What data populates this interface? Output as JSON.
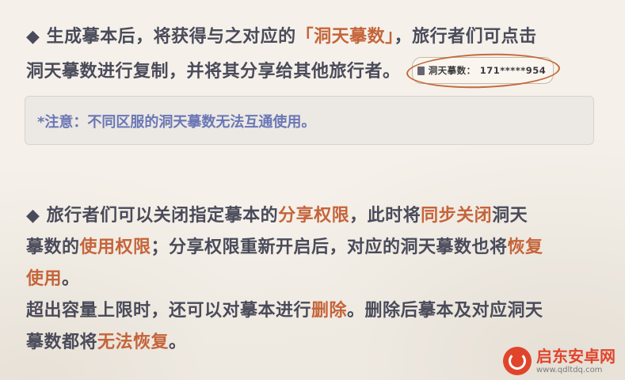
{
  "section1": {
    "bullet": "◆",
    "line1_a": "生成摹本后，将获得与之对应的",
    "line1_bracket_open": "「",
    "line1_hl": "洞天摹数",
    "line1_bracket_close": "」",
    "line1_b": "，旅行者们可点击",
    "line2": "洞天摹数进行复制，并将其分享给其他旅行者。",
    "chip_label": "洞天摹数：",
    "chip_value": "171*****954"
  },
  "note": {
    "text": "*注意：不同区服的洞天摹数无法互通使用。"
  },
  "section2": {
    "bullet": "◆",
    "l1_a": "旅行者们可以关闭指定摹本的",
    "l1_hl1": "分享权限",
    "l1_b": "，此时将",
    "l1_hl2": "同步关闭",
    "l1_c": "洞天",
    "l2_a": "摹数的",
    "l2_hl1": "使用权限",
    "l2_b": "；分享权限重新开启后，对应的洞天摹数也将",
    "l2_hl2": "恢复",
    "l3_hl": "使用",
    "l3_end": "。",
    "l4_a": "超出容量上限时，还可以对摹本进行",
    "l4_hl": "删除",
    "l4_b": "。删除后摹本及对应洞天",
    "l5_a": "摹数都将",
    "l5_hl": "无法恢复",
    "l5_end": "。"
  },
  "watermark": {
    "title": "启东安卓网",
    "url": "www.qdltdq.com"
  },
  "colors": {
    "text": "#4a4b5a",
    "highlight": "#c5643a",
    "note_text": "#6a77b6",
    "note_bg": "#ece8e3",
    "watermark": "#e0452c"
  }
}
